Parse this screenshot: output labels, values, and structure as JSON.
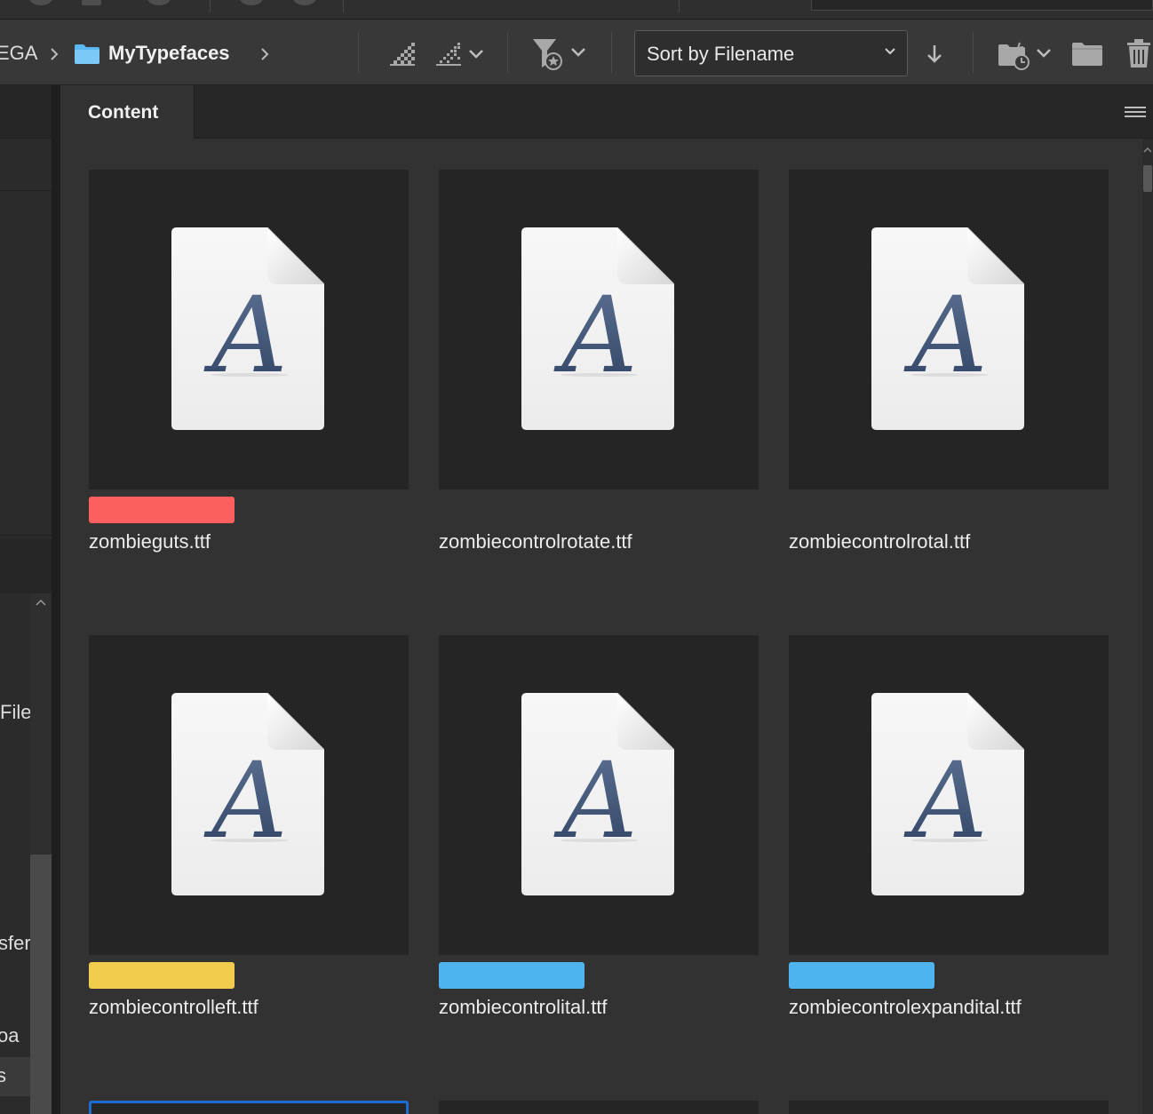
{
  "breadcrumb": {
    "previous": "EGA",
    "current": "MyTypefaces"
  },
  "toolbar": {
    "sort_label": "Sort by Filename"
  },
  "sidebar": {
    "fragments": [
      "File",
      "sfer",
      "oa",
      "s"
    ]
  },
  "panel": {
    "tab_label": "Content"
  },
  "label_colors": {
    "red": "#fd5e5e",
    "yellow": "#f1cc4c",
    "blue": "#4db4f0"
  },
  "files": [
    {
      "name": "zombieguts.ttf",
      "label": "red"
    },
    {
      "name": "zombiecontrolrotate.ttf",
      "label": null
    },
    {
      "name": "zombiecontrolrotal.ttf",
      "label": null
    },
    {
      "name": "zombiecontrolleft.ttf",
      "label": "yellow"
    },
    {
      "name": "zombiecontrolital.ttf",
      "label": "blue"
    },
    {
      "name": "zombiecontrolexpandital.ttf",
      "label": "blue"
    }
  ]
}
